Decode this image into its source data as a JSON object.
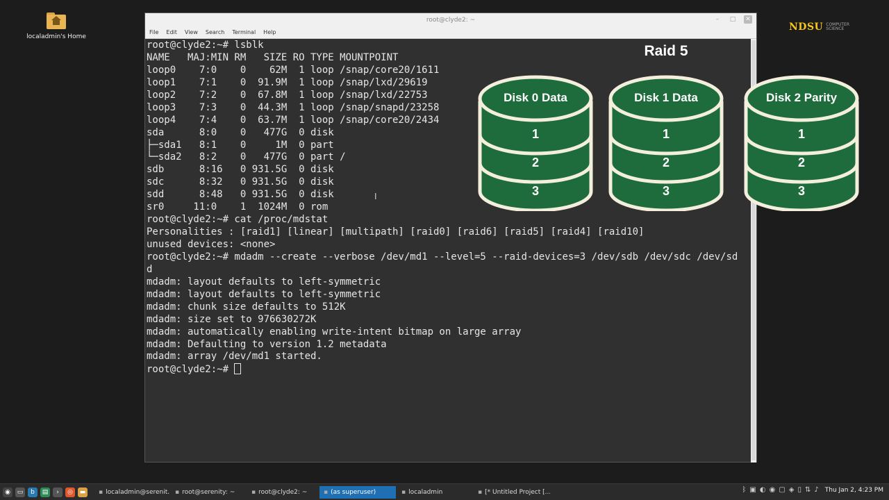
{
  "desktop": {
    "home_label": "localadmin's Home",
    "brand_main": "NDSU",
    "brand_sub_1": "COMPUTER",
    "brand_sub_2": "SCIENCE"
  },
  "window": {
    "title": "root@clyde2: ~",
    "menu": [
      "File",
      "Edit",
      "View",
      "Search",
      "Terminal",
      "Help"
    ]
  },
  "terminal": {
    "lines": [
      "root@clyde2:~# lsblk",
      "NAME   MAJ:MIN RM   SIZE RO TYPE MOUNTPOINT",
      "loop0    7:0    0    62M  1 loop /snap/core20/1611",
      "loop1    7:1    0  91.9M  1 loop /snap/lxd/29619",
      "loop2    7:2    0  67.8M  1 loop /snap/lxd/22753",
      "loop3    7:3    0  44.3M  1 loop /snap/snapd/23258",
      "loop4    7:4    0  63.7M  1 loop /snap/core20/2434",
      "sda      8:0    0   477G  0 disk",
      "├─sda1   8:1    0     1M  0 part",
      "└─sda2   8:2    0   477G  0 part /",
      "sdb      8:16   0 931.5G  0 disk",
      "sdc      8:32   0 931.5G  0 disk",
      "sdd      8:48   0 931.5G  0 disk",
      "sr0     11:0    1  1024M  0 rom",
      "root@clyde2:~# cat /proc/mdstat",
      "Personalities : [raid1] [linear] [multipath] [raid0] [raid6] [raid5] [raid4] [raid10]",
      "unused devices: <none>",
      "root@clyde2:~# mdadm --create --verbose /dev/md1 --level=5 --raid-devices=3 /dev/sdb /dev/sdc /dev/sd",
      "d",
      "mdadm: layout defaults to left-symmetric",
      "mdadm: layout defaults to left-symmetric",
      "mdadm: chunk size defaults to 512K",
      "mdadm: size set to 976630272K",
      "mdadm: automatically enabling write-intent bitmap on large array",
      "mdadm: Defaulting to version 1.2 metadata",
      "mdadm: array /dev/md1 started."
    ],
    "prompt": "root@clyde2:~# "
  },
  "raid": {
    "title": "Raid 5",
    "disks": [
      {
        "name": "Disk 0 Data",
        "segments": [
          "1",
          "2",
          "3"
        ]
      },
      {
        "name": "Disk 1 Data",
        "segments": [
          "1",
          "2",
          "3"
        ]
      },
      {
        "name": "Disk 2 Parity",
        "segments": [
          "1",
          "2",
          "3"
        ]
      }
    ],
    "disk_color": "#1e6b3c",
    "outline_color": "#f3efdc"
  },
  "taskbar": {
    "tasks": [
      {
        "label": "localadmin@serenit...",
        "active": false
      },
      {
        "label": "root@serenity: ~",
        "active": false
      },
      {
        "label": "root@clyde2: ~",
        "active": false
      },
      {
        "label": "(as superuser)",
        "active": true
      },
      {
        "label": "localadmin",
        "active": false
      },
      {
        "label": "[* Untitled Project [...",
        "active": false
      }
    ],
    "clock": "Thu Jan  2,  4:23 PM"
  }
}
